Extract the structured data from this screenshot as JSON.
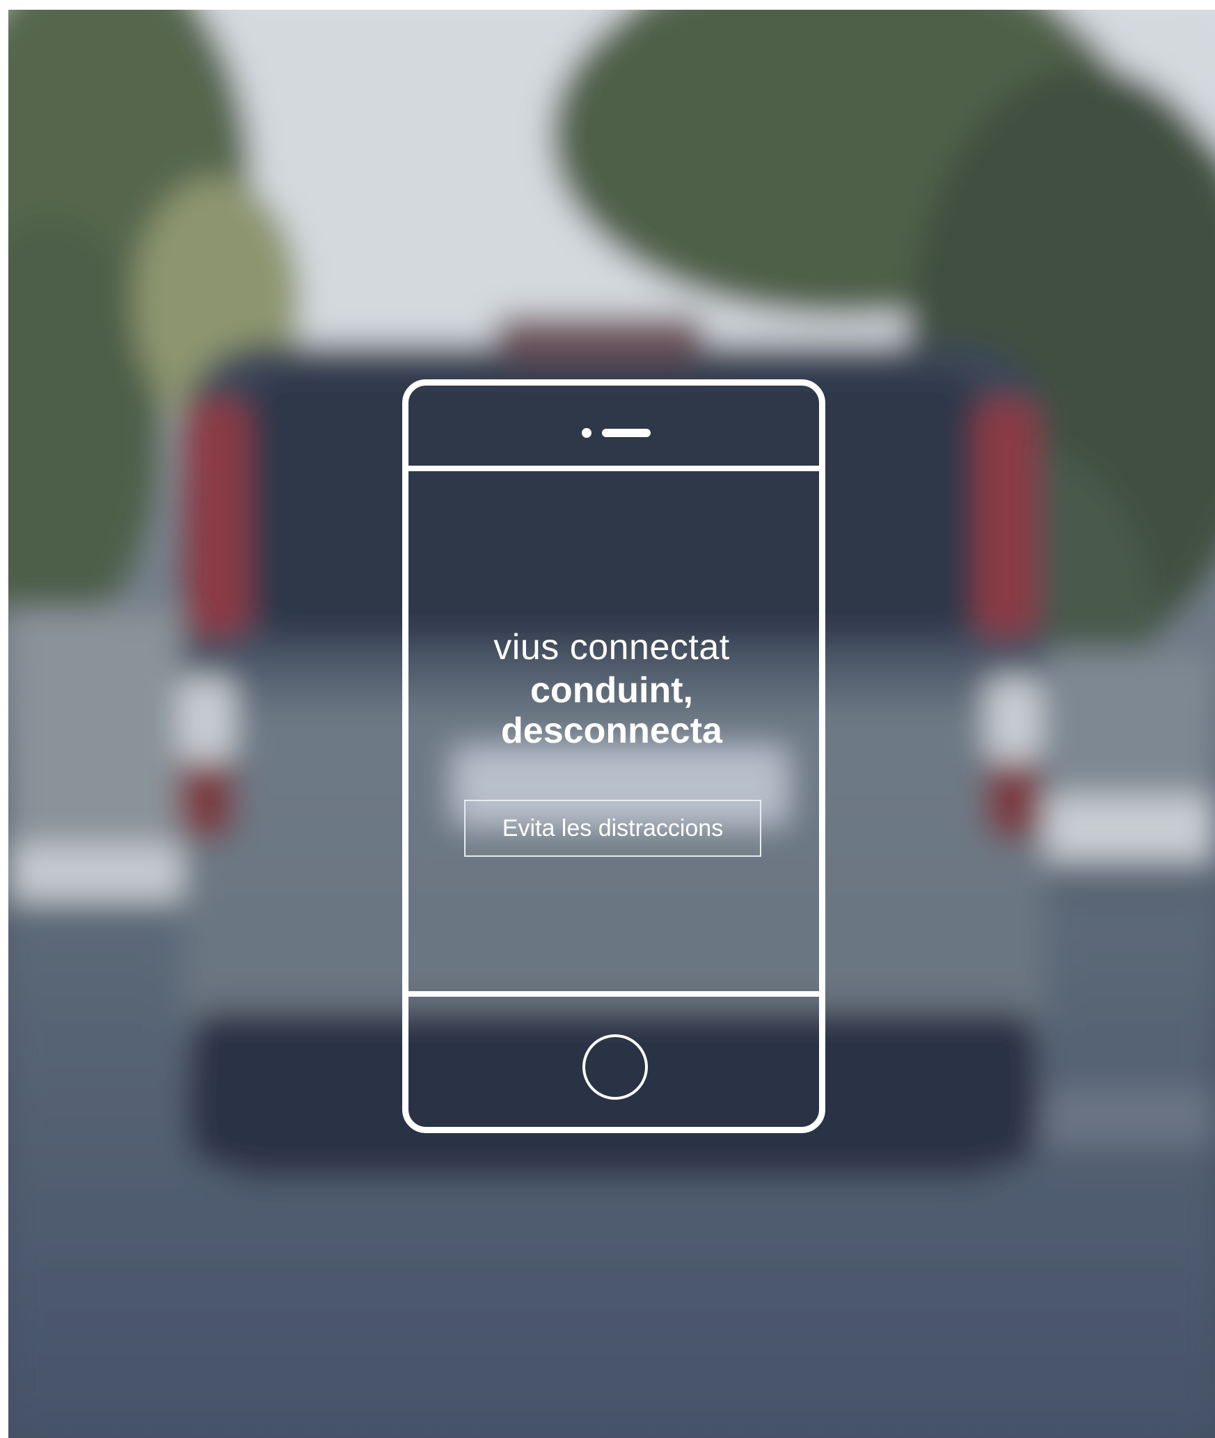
{
  "message": {
    "line1": "vius connectat",
    "line2": "conduint,",
    "line3": "desconnecta"
  },
  "cta": {
    "label": "Evita les distraccions"
  },
  "colors": {
    "text": "#ffffff",
    "phone_outline": "#ffffff",
    "road": "#4a5566",
    "sky": "#d6dbe0"
  },
  "icons": {
    "phone": "smartphone-outline-icon",
    "speaker": "speaker-icon",
    "home": "home-button-icon"
  }
}
